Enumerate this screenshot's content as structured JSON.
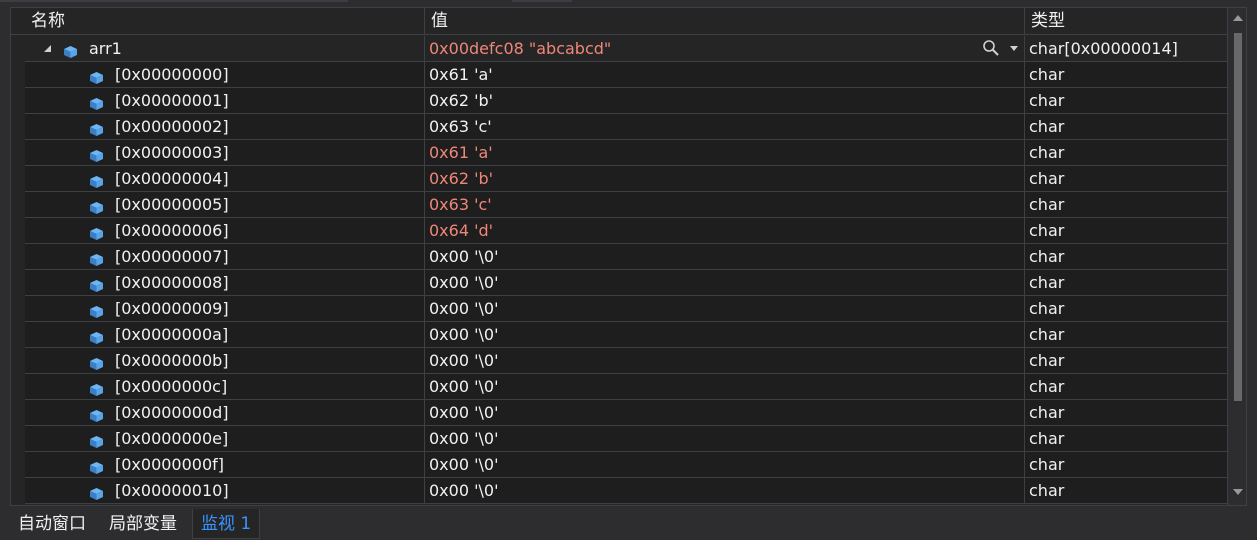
{
  "header": {
    "name_col": "名称",
    "value_col": "值",
    "type_col": "类型"
  },
  "root": {
    "name": "arr1",
    "value": "0x00defc08 \"abcabcd\"",
    "type": "char[0x00000014]",
    "expanded": true,
    "value_changed": true
  },
  "elements": [
    {
      "name": "[0x00000000]",
      "value": "0x61 'a'",
      "type": "char",
      "changed": false
    },
    {
      "name": "[0x00000001]",
      "value": "0x62 'b'",
      "type": "char",
      "changed": false
    },
    {
      "name": "[0x00000002]",
      "value": "0x63 'c'",
      "type": "char",
      "changed": false
    },
    {
      "name": "[0x00000003]",
      "value": "0x61 'a'",
      "type": "char",
      "changed": true
    },
    {
      "name": "[0x00000004]",
      "value": "0x62 'b'",
      "type": "char",
      "changed": true
    },
    {
      "name": "[0x00000005]",
      "value": "0x63 'c'",
      "type": "char",
      "changed": true
    },
    {
      "name": "[0x00000006]",
      "value": "0x64 'd'",
      "type": "char",
      "changed": true
    },
    {
      "name": "[0x00000007]",
      "value": "0x00 '\\0'",
      "type": "char",
      "changed": false
    },
    {
      "name": "[0x00000008]",
      "value": "0x00 '\\0'",
      "type": "char",
      "changed": false
    },
    {
      "name": "[0x00000009]",
      "value": "0x00 '\\0'",
      "type": "char",
      "changed": false
    },
    {
      "name": "[0x0000000a]",
      "value": "0x00 '\\0'",
      "type": "char",
      "changed": false
    },
    {
      "name": "[0x0000000b]",
      "value": "0x00 '\\0'",
      "type": "char",
      "changed": false
    },
    {
      "name": "[0x0000000c]",
      "value": "0x00 '\\0'",
      "type": "char",
      "changed": false
    },
    {
      "name": "[0x0000000d]",
      "value": "0x00 '\\0'",
      "type": "char",
      "changed": false
    },
    {
      "name": "[0x0000000e]",
      "value": "0x00 '\\0'",
      "type": "char",
      "changed": false
    },
    {
      "name": "[0x0000000f]",
      "value": "0x00 '\\0'",
      "type": "char",
      "changed": false
    },
    {
      "name": "[0x00000010]",
      "value": "0x00 '\\0'",
      "type": "char",
      "changed": false
    }
  ],
  "tabs": [
    {
      "label": "自动窗口",
      "active": false
    },
    {
      "label": "局部变量",
      "active": false
    },
    {
      "label": "监视 1",
      "active": true
    }
  ],
  "colors": {
    "changed_value": "#ef8779",
    "active_tab": "#3794ff",
    "field_icon": "#6cb6f5"
  },
  "icons": {
    "field": "field-icon",
    "search": "search-icon",
    "expand": "expand-arrow-icon",
    "dropdown": "chevron-down-icon"
  }
}
